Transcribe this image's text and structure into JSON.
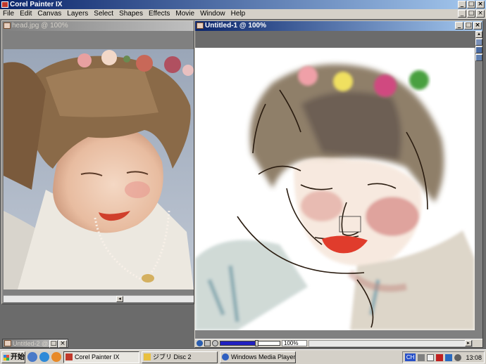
{
  "app": {
    "title": "Corel Painter IX"
  },
  "menu": [
    "File",
    "Edit",
    "Canvas",
    "Layers",
    "Select",
    "Shapes",
    "Effects",
    "Movie",
    "Window",
    "Help"
  ],
  "window_buttons": {
    "minimize": "_",
    "restore": "□",
    "close": "×"
  },
  "doc_left": {
    "title": "head.jpg @ 100%"
  },
  "doc_right": {
    "title": "Untitled-1 @ 100%",
    "zoom": "100%",
    "zoom_level": 0.62
  },
  "minimized": {
    "title": "Untitled-2 @..."
  },
  "scroll": {
    "left": "◂",
    "right": "▸",
    "up": "▴",
    "down": "▾"
  },
  "taskbar": {
    "start": "开始",
    "tasks": [
      {
        "label": "Corel Painter IX",
        "pressed": true
      },
      {
        "label": "ジブリ Disc 2",
        "pressed": false
      },
      {
        "label": "Windows Media Player",
        "pressed": false
      }
    ],
    "lang": "CH",
    "clock": "13:08"
  },
  "colors": {
    "title_active": "#0a246a",
    "workspace": "#6b6b6b",
    "lips": "#d0402c",
    "hair": "#4a3320"
  }
}
